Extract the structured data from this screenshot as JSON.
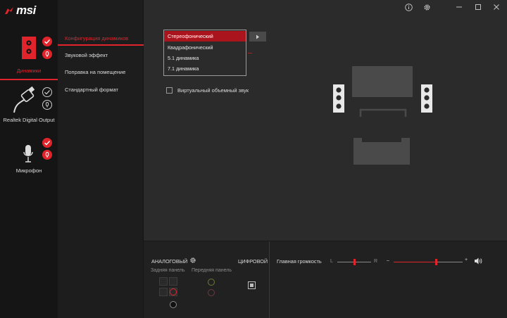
{
  "brand": {
    "name": "msi"
  },
  "devices": [
    {
      "label": "Динамики",
      "active": true
    },
    {
      "label": "Realtek Digital Output",
      "active": false
    },
    {
      "label": "Микрофон",
      "active": false
    }
  ],
  "menu": {
    "items": [
      {
        "label": "Конфигурация динамиков",
        "active": true
      },
      {
        "label": "Звуковой эффект",
        "active": false
      },
      {
        "label": "Поправка на помещение",
        "active": false
      },
      {
        "label": "Стандартный формат",
        "active": false
      }
    ]
  },
  "speaker_config": {
    "options": [
      "Стереофонический",
      "Квадрафонический",
      "5.1 динамика",
      "7.1 динамика"
    ],
    "selected": "Стереофонический"
  },
  "virtual_surround": {
    "label": "Виртуальный объемный звук",
    "checked": false
  },
  "bottom": {
    "analog_label": "АНАЛОГОВЫЙ",
    "digital_label": "ЦИФРОВОЙ",
    "rear_panel": "Задняя панель",
    "front_panel": "Передняя панель",
    "master_volume": "Главная громкость",
    "balance_left": "L",
    "balance_right": "R",
    "vol_minus": "–",
    "vol_plus": "+",
    "balance": 0.5,
    "volume": 0.62
  },
  "colors": {
    "accent": "#e1242b",
    "sidebar": "#151515",
    "background": "#2b2b2b"
  },
  "icons": [
    "info-icon",
    "gear-icon",
    "minimize-icon",
    "maximize-icon",
    "close-icon",
    "speaker-volume-icon"
  ]
}
